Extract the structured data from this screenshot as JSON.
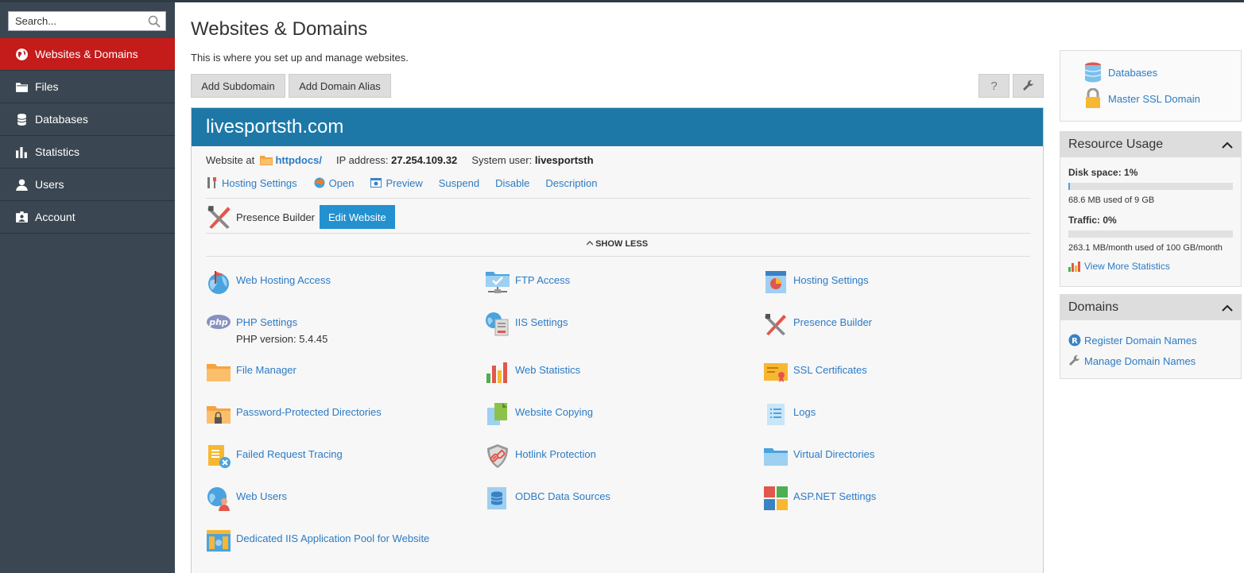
{
  "sidebar": {
    "search_placeholder": "Search...",
    "items": [
      {
        "label": "Websites & Domains",
        "active": true
      },
      {
        "label": "Files"
      },
      {
        "label": "Databases"
      },
      {
        "label": "Statistics"
      },
      {
        "label": "Users"
      },
      {
        "label": "Account"
      }
    ]
  },
  "main": {
    "title": "Websites & Domains",
    "description": "This is where you set up and manage websites.",
    "buttons": {
      "add_subdomain": "Add Subdomain",
      "add_alias": "Add Domain Alias",
      "help": "?"
    },
    "domain": {
      "name": "livesportsth.com",
      "website_at": "Website at",
      "docroot": "httpdocs/",
      "ip_label": "IP address:",
      "ip": "27.254.109.32",
      "user_label": "System user:",
      "user": "livesportsth",
      "links": [
        "Hosting Settings",
        "Open",
        "Preview",
        "Suspend",
        "Disable",
        "Description"
      ],
      "presence_label": "Presence Builder",
      "edit_website": "Edit Website",
      "show_less": "SHOW LESS",
      "tools": [
        {
          "label": "Web Hosting Access"
        },
        {
          "label": "FTP Access"
        },
        {
          "label": "Hosting Settings"
        },
        {
          "label": "PHP Settings",
          "sub": "PHP version: 5.4.45"
        },
        {
          "label": "IIS Settings"
        },
        {
          "label": "Presence Builder"
        },
        {
          "label": "File Manager"
        },
        {
          "label": "Web Statistics"
        },
        {
          "label": "SSL Certificates"
        },
        {
          "label": "Password-Protected Directories"
        },
        {
          "label": "Website Copying"
        },
        {
          "label": "Logs"
        },
        {
          "label": "Failed Request Tracing"
        },
        {
          "label": "Hotlink Protection"
        },
        {
          "label": "Virtual Directories"
        },
        {
          "label": "Web Users"
        },
        {
          "label": "ODBC Data Sources"
        },
        {
          "label": "ASP.NET Settings"
        },
        {
          "label": "Dedicated IIS Application Pool for Website"
        }
      ]
    }
  },
  "right": {
    "quick_links": [
      "Databases",
      "Master SSL Domain"
    ],
    "resource": {
      "title": "Resource Usage",
      "disk_label": "Disk space: 1%",
      "disk_fraction": 0.01,
      "disk_text": "68.6 MB used of 9 GB",
      "traffic_label": "Traffic: 0%",
      "traffic_fraction": 0.0,
      "traffic_text": "263.1 MB/month used of 100 GB/month",
      "more": "View More Statistics"
    },
    "domains": {
      "title": "Domains",
      "links": [
        "Register Domain Names",
        "Manage Domain Names"
      ]
    }
  },
  "colors": {
    "accent": "#2c7bc5",
    "active_nav": "#c41b1b",
    "domain_header": "#1d78a8",
    "sidebar_bg": "#3a4651"
  }
}
